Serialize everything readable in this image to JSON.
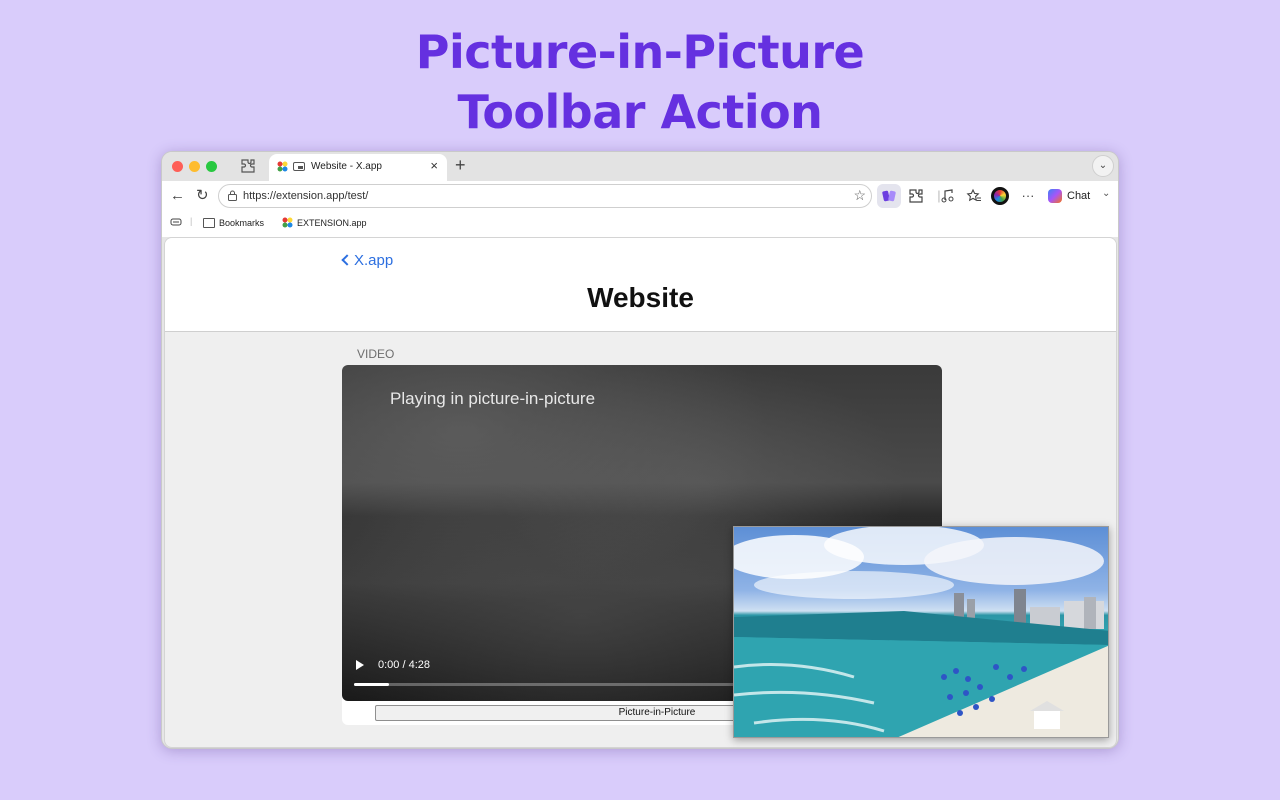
{
  "hero": {
    "line1": "Picture-in-Picture",
    "line2": "Toolbar Action"
  },
  "browser": {
    "tab": {
      "title": "Website - X.app",
      "close": "×"
    },
    "new_tab": "+",
    "tabs_menu": "⌄",
    "toolbar": {
      "back": "←",
      "reload": "↻",
      "url": "https://extension.app/test/",
      "star": "☆",
      "chat_label": "Chat",
      "chat_chevron": "⌄",
      "more": "···"
    },
    "bookmarks": [
      {
        "label": "Bookmarks",
        "icon": "folder-icon"
      },
      {
        "label": "EXTENSION.app",
        "icon": "extension-favicon"
      }
    ]
  },
  "page": {
    "back_label": "X.app",
    "title": "Website",
    "section_label": "VIDEO",
    "video": {
      "overlay_text": "Playing in picture-in-picture",
      "time": "0:00 / 4:28",
      "progress_fraction": 0.06
    },
    "pip_button_label": "Picture-in-Picture"
  },
  "colors": {
    "background": "#d9ccfb",
    "hero_text": "#6530e0",
    "link": "#2c6fe0"
  }
}
